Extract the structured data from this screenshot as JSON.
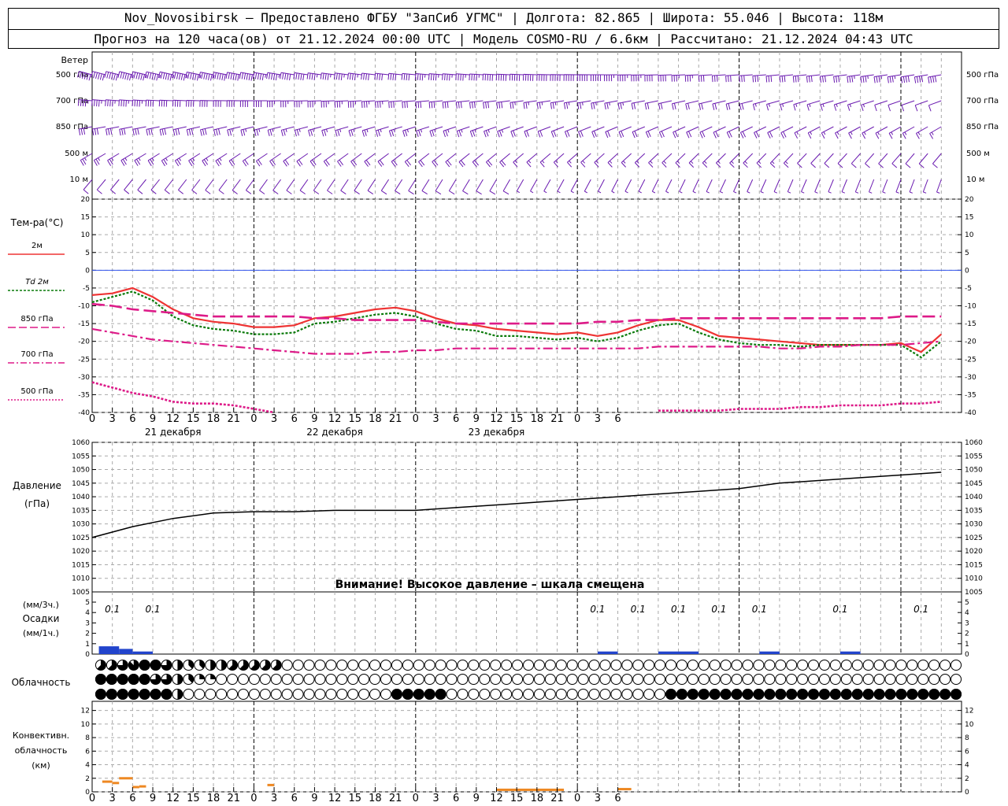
{
  "header": {
    "line1": "Nov_Novosibirsk – Предоставлено ФГБУ \"ЗапСиб УГМС\" | Долгота: 82.865 | Широта: 55.046 | Высота: 118м",
    "line2": "Прогноз на 120 часа(ов) от 21.12.2024 00:00 UTC  | Модель COSMO-RU / 6.6км | Рассчитано: 21.12.2024 04:43 UTC"
  },
  "colors": {
    "t2m": "#ee3333",
    "td2m": "#0a7a0a",
    "t850": "#dd1a88",
    "t700": "#dd1a88",
    "t500": "#dd1a88",
    "pressure": "#000000",
    "wind": "#6a1ab0",
    "precip": "#2244cc",
    "conv": "#ee8822",
    "zero": "#3355ee"
  },
  "x_axis": {
    "ticks": [
      "0",
      "3",
      "6",
      "9",
      "12",
      "15",
      "18",
      "21",
      "0",
      "3",
      "6",
      "9",
      "12",
      "15",
      "18",
      "21",
      "0",
      "3",
      "6",
      "9",
      "12",
      "15",
      "18",
      "21",
      "0",
      "3",
      "6"
    ],
    "dates": [
      "21 декабря",
      "22 декабря",
      "23 декабря"
    ]
  },
  "wind_panel": {
    "title": "Ветер",
    "levels": [
      "500 гПа",
      "700 гПа",
      "850 гПа",
      "500 м",
      "10 м"
    ]
  },
  "temp_panel": {
    "title": "Тем-ра(°C)",
    "legend": [
      "2м",
      "Td 2м",
      "850 гПа",
      "700 гПа",
      "500 гПа"
    ],
    "yticks": [
      "20",
      "15",
      "10",
      "5",
      "0",
      "-5",
      "-10",
      "-15",
      "-20",
      "-25",
      "-30",
      "-35",
      "-40"
    ]
  },
  "pressure_panel": {
    "title": "Давление",
    "unit": "(гПа)",
    "note": "Внимание! Высокое давление – шкала смещена",
    "yticks": [
      "1060",
      "1055",
      "1050",
      "1045",
      "1040",
      "1035",
      "1030",
      "1025",
      "1020",
      "1015",
      "1010",
      "1005"
    ]
  },
  "precip_panel": {
    "label1": "(мм/3ч.)",
    "label2": "Осадки",
    "label3": "(мм/1ч.)",
    "yticks": [
      "5",
      "4",
      "3",
      "2",
      "1",
      "0"
    ],
    "labels": [
      {
        "h": 3,
        "text": "0.1"
      },
      {
        "h": 9,
        "text": "0.1"
      },
      {
        "h": 75,
        "text": "0.1"
      },
      {
        "h": 81,
        "text": "0.1"
      },
      {
        "h": 87,
        "text": "0.1"
      },
      {
        "h": 93,
        "text": "0.1"
      },
      {
        "h": 99,
        "text": "0.1"
      },
      {
        "h": 111,
        "text": "0.1"
      },
      {
        "h": 123,
        "text": "0.1"
      }
    ]
  },
  "cloud_panel": {
    "title": "Облачность"
  },
  "conv_panel": {
    "label1": "Конвективн.",
    "label2": "облачность",
    "label3": "(км)",
    "yticks": [
      "12",
      "10",
      "8",
      "6",
      "4",
      "2",
      "0"
    ]
  },
  "chart_data": [
    {
      "type": "line",
      "name": "temperature",
      "ylim": [
        -40,
        20
      ],
      "x_hours": [
        0,
        3,
        6,
        9,
        12,
        15,
        18,
        21,
        24,
        27,
        30,
        33,
        36,
        39,
        42,
        45,
        48,
        51,
        54,
        57,
        60,
        63,
        66,
        69,
        72,
        75,
        78,
        81,
        84,
        87,
        90,
        93,
        96,
        99,
        102,
        105,
        108,
        111,
        114,
        117,
        120,
        123,
        126
      ],
      "series": [
        {
          "name": "2м",
          "values": [
            -7,
            -6.5,
            -5,
            -7.5,
            -11,
            -13.5,
            -14.5,
            -15,
            -16,
            -16,
            -15.5,
            -13.5,
            -13,
            -12,
            -11,
            -10.5,
            -11.5,
            -13.5,
            -15,
            -15.5,
            -16.5,
            -17,
            -17.5,
            -18,
            -17.5,
            -18.5,
            -17.5,
            -15.5,
            -14,
            -14,
            -16,
            -18.5,
            -19,
            -19.5,
            -20,
            -20.5,
            -21,
            -21,
            -21,
            -21,
            -20.5,
            -23,
            -18
          ]
        },
        {
          "name": "Td 2м",
          "values": [
            -9,
            -7.5,
            -6,
            -8.5,
            -13,
            -15.5,
            -16.5,
            -17,
            -18,
            -18,
            -17.5,
            -15,
            -14.5,
            -13.5,
            -12.5,
            -12,
            -13,
            -15,
            -16.5,
            -17,
            -18.5,
            -18.5,
            -19,
            -19.5,
            -19,
            -20,
            -19,
            -17,
            -15.5,
            -15,
            -17.5,
            -19.5,
            -20.5,
            -21,
            -21,
            -21.5,
            -21,
            -21,
            -21,
            -21,
            -21,
            -24.5,
            -20
          ]
        },
        {
          "name": "850 гПа",
          "values": [
            -9.5,
            -10,
            -11,
            -11.5,
            -12,
            -12.5,
            -13,
            -13,
            -13,
            -13,
            -13,
            -13.5,
            -13.5,
            -14,
            -14,
            -14,
            -14,
            -14.5,
            -15,
            -15,
            -15,
            -15,
            -15,
            -15,
            -15,
            -14.5,
            -14.5,
            -14,
            -14,
            -13.5,
            -13.5,
            -13.5,
            -13.5,
            -13.5,
            -13.5,
            -13.5,
            -13.5,
            -13.5,
            -13.5,
            -13.5,
            -13,
            -13,
            -13
          ]
        },
        {
          "name": "700 гПа",
          "values": [
            -16.5,
            -17.5,
            -18.5,
            -19.5,
            -20,
            -20.5,
            -21,
            -21.5,
            -22,
            -22.5,
            -23,
            -23.5,
            -23.5,
            -23.5,
            -23,
            -23,
            -22.5,
            -22.5,
            -22,
            -22,
            -22,
            -22,
            -22,
            -22,
            -22,
            -22,
            -22,
            -22,
            -21.5,
            -21.5,
            -21.5,
            -21.5,
            -21.5,
            -21.5,
            -22,
            -22,
            -21.5,
            -21.5,
            -21,
            -21,
            -21,
            -20.5,
            -20
          ]
        },
        {
          "name": "500 гПа",
          "values": [
            -31.5,
            -33,
            -34.5,
            -35.5,
            -37,
            -37.5,
            -37.5,
            -38,
            -39,
            -40,
            null,
            null,
            null,
            null,
            null,
            null,
            null,
            null,
            null,
            null,
            null,
            null,
            null,
            null,
            null,
            null,
            null,
            null,
            -39.5,
            -39.5,
            -39.5,
            -39.5,
            -39,
            -39,
            -39,
            -38.5,
            -38.5,
            -38,
            -38,
            -38,
            -37.5,
            -37.5,
            -37
          ]
        }
      ]
    },
    {
      "type": "line",
      "name": "pressure",
      "ylim": [
        1005,
        1060
      ],
      "x_hours": [
        0,
        6,
        12,
        18,
        24,
        30,
        36,
        42,
        48,
        54,
        60,
        66,
        72,
        78,
        84,
        90,
        96,
        102,
        108,
        114,
        120,
        126
      ],
      "values": [
        1025,
        1029,
        1032,
        1034,
        1034.5,
        1034.5,
        1035,
        1035,
        1035,
        1036,
        1037,
        1038,
        1039,
        1040,
        1041,
        1042,
        1043,
        1045,
        1046,
        1047,
        1048,
        1049
      ]
    },
    {
      "type": "bar",
      "name": "precipitation",
      "ylim": [
        0,
        5
      ],
      "bars": [
        {
          "h0": 1,
          "h1": 4,
          "v": 0.15
        },
        {
          "h0": 4,
          "h1": 6,
          "v": 0.1
        },
        {
          "h0": 6,
          "h1": 9,
          "v": 0.05
        },
        {
          "h0": 75,
          "h1": 78,
          "v": 0.05
        },
        {
          "h0": 84,
          "h1": 90,
          "v": 0.05
        },
        {
          "h0": 99,
          "h1": 102,
          "v": 0.05
        },
        {
          "h0": 111,
          "h1": 114,
          "v": 0.05
        }
      ]
    },
    {
      "type": "bar",
      "name": "convective_cloud",
      "ylim": [
        0,
        13
      ],
      "bars": [
        {
          "h0": 1.5,
          "h1": 3,
          "v": 1.5
        },
        {
          "h0": 3,
          "h1": 4,
          "v": 1.3
        },
        {
          "h0": 4,
          "h1": 6,
          "v": 2
        },
        {
          "h0": 6,
          "h1": 7,
          "v": 0.7
        },
        {
          "h0": 7,
          "h1": 8,
          "v": 0.8
        },
        {
          "h0": 26,
          "h1": 27,
          "v": 1
        },
        {
          "h0": 60,
          "h1": 70,
          "v": 0.3
        },
        {
          "h0": 78,
          "h1": 80,
          "v": 0.4
        }
      ]
    },
    {
      "type": "table",
      "name": "cloudiness",
      "note": "octas per 1-h slot, rows top to bottom",
      "rows": [
        {
          "start": 0,
          "count": 79,
          "codes": [
            5,
            5,
            6,
            7,
            8,
            8,
            6,
            4,
            3,
            3,
            4,
            4,
            5,
            5,
            5,
            5,
            5,
            0,
            0,
            0,
            0,
            0,
            0,
            0,
            0,
            0,
            0,
            0,
            0,
            0,
            0,
            0,
            0,
            0,
            0,
            0,
            0,
            0,
            0,
            0,
            0,
            0,
            0,
            0,
            0,
            0,
            0,
            0,
            0,
            0,
            0,
            0,
            0,
            0,
            0,
            0,
            0,
            0,
            0,
            0,
            0,
            0,
            0,
            0,
            0,
            0,
            0,
            0,
            0,
            0,
            0,
            0,
            0,
            0,
            0,
            0,
            0,
            0,
            0
          ]
        },
        {
          "start": 0,
          "count": 79,
          "codes": [
            8,
            8,
            8,
            8,
            8,
            6,
            6,
            4,
            3,
            2,
            2,
            0,
            0,
            0,
            0,
            0,
            0,
            0,
            0,
            0,
            0,
            0,
            0,
            0,
            0,
            0,
            0,
            0,
            0,
            0,
            0,
            0,
            0,
            0,
            0,
            0,
            0,
            0,
            0,
            0,
            0,
            0,
            0,
            0,
            0,
            0,
            0,
            0,
            0,
            0,
            0,
            0,
            0,
            0,
            0,
            0,
            0,
            0,
            0,
            0,
            0,
            0,
            0,
            0,
            0,
            0,
            0,
            0,
            0,
            0,
            0,
            0,
            0,
            0,
            0,
            0,
            0,
            0,
            0
          ]
        },
        {
          "start": 0,
          "count": 79,
          "codes": [
            8,
            8,
            8,
            8,
            8,
            8,
            8,
            4,
            0,
            0,
            0,
            0,
            0,
            0,
            0,
            0,
            0,
            0,
            0,
            0,
            0,
            0,
            0,
            0,
            0,
            0,
            0,
            8,
            8,
            8,
            8,
            8,
            0,
            0,
            0,
            0,
            0,
            0,
            0,
            0,
            0,
            0,
            0,
            0,
            0,
            0,
            0,
            0,
            0,
            0,
            0,
            0,
            8,
            8,
            8,
            8,
            8,
            8,
            8,
            8,
            8,
            8,
            8,
            8,
            8,
            8,
            8,
            8,
            8,
            8,
            8,
            8,
            8,
            8,
            8,
            8,
            8,
            8,
            8
          ]
        }
      ]
    },
    {
      "type": "table",
      "name": "wind_barbs",
      "note": "direction (deg from) and speed (kt) per level",
      "levels": [
        "500 гПа",
        "700 гПа",
        "850 гПа",
        "500 м",
        "10 м"
      ],
      "rows": [
        {
          "level": "500 гПа",
          "dir_start": 285,
          "dir_end": 260,
          "spd_start": 60,
          "spd_end": 30
        },
        {
          "level": "700 гПа",
          "dir_start": 275,
          "dir_end": 250,
          "spd_start": 45,
          "spd_end": 10
        },
        {
          "level": "850 гПа",
          "dir_start": 260,
          "dir_end": 240,
          "spd_start": 30,
          "spd_end": 15
        },
        {
          "level": "500 м",
          "dir_start": 240,
          "dir_end": 220,
          "spd_start": 25,
          "spd_end": 10
        },
        {
          "level": "10 м",
          "dir_start": 220,
          "dir_end": 200,
          "spd_start": 10,
          "spd_end": 5
        }
      ]
    }
  ]
}
